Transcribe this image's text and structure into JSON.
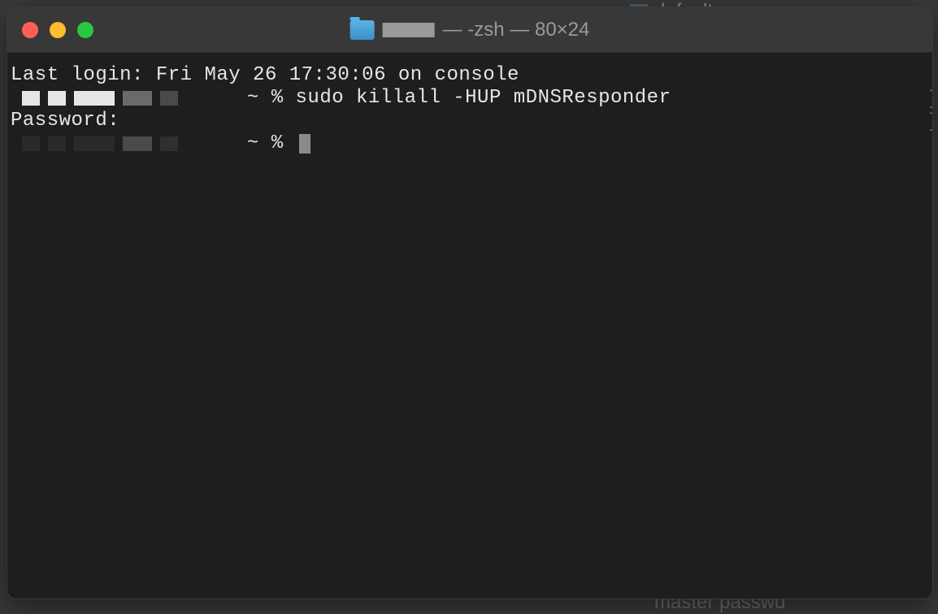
{
  "background": {
    "top_fragment": "defaults",
    "bottom_fragment": "master passwd"
  },
  "window": {
    "title_suffix": "— -zsh — 80×24",
    "traffic_lights": {
      "close": "close",
      "minimize": "minimize",
      "maximize": "maximize"
    }
  },
  "terminal": {
    "lines": {
      "last_login": "Last login: Fri May 26 17:30:06 on console",
      "prompt1_prefix": " ~ % ",
      "command1": "sudo killall -HUP mDNSResponder",
      "password_label": "Password:",
      "prompt2_prefix": " ~ % "
    }
  }
}
